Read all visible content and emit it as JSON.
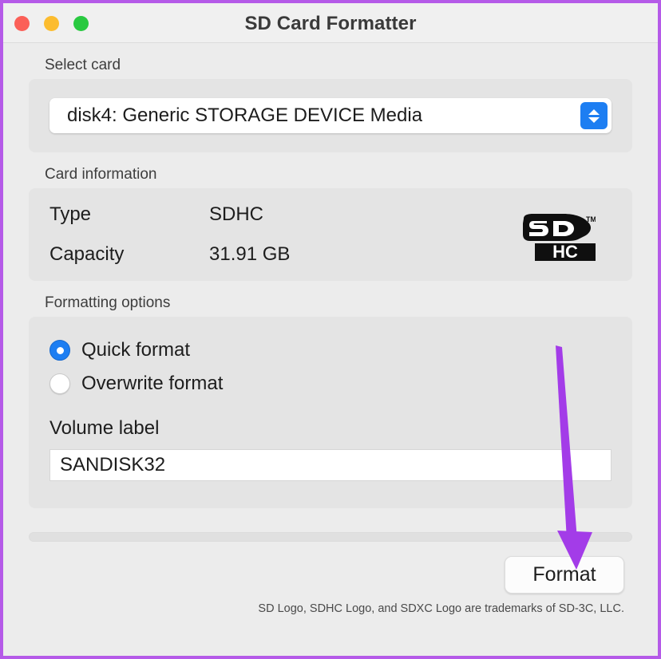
{
  "window": {
    "title": "SD Card Formatter",
    "traffic_lights": [
      {
        "name": "close",
        "color": "#fb5f57"
      },
      {
        "name": "minimize",
        "color": "#fcbc2e"
      },
      {
        "name": "maximize",
        "color": "#29c940"
      }
    ],
    "annotation_arrow_color": "#a33ce8",
    "border_color": "#b55ae8"
  },
  "select_card": {
    "label": "Select card",
    "selected": "disk4: Generic STORAGE DEVICE Media",
    "stepper_color": "#1d7ef2"
  },
  "card_information": {
    "label": "Card information",
    "rows": [
      {
        "key": "Type",
        "value": "SDHC"
      },
      {
        "key": "Capacity",
        "value": "31.91 GB"
      }
    ],
    "logo_text": {
      "top": "SD",
      "bottom": "HC",
      "tm": "TM"
    }
  },
  "formatting_options": {
    "label": "Formatting options",
    "options": [
      {
        "label": "Quick format",
        "selected": true
      },
      {
        "label": "Overwrite format",
        "selected": false
      }
    ],
    "volume_label_title": "Volume label",
    "volume_label_value": "SANDISK32",
    "volume_label_placeholder": ""
  },
  "progress": {
    "value": 0
  },
  "footer": {
    "format_button": "Format",
    "trademark": "SD Logo, SDHC Logo, and SDXC Logo are trademarks of SD-3C, LLC."
  }
}
